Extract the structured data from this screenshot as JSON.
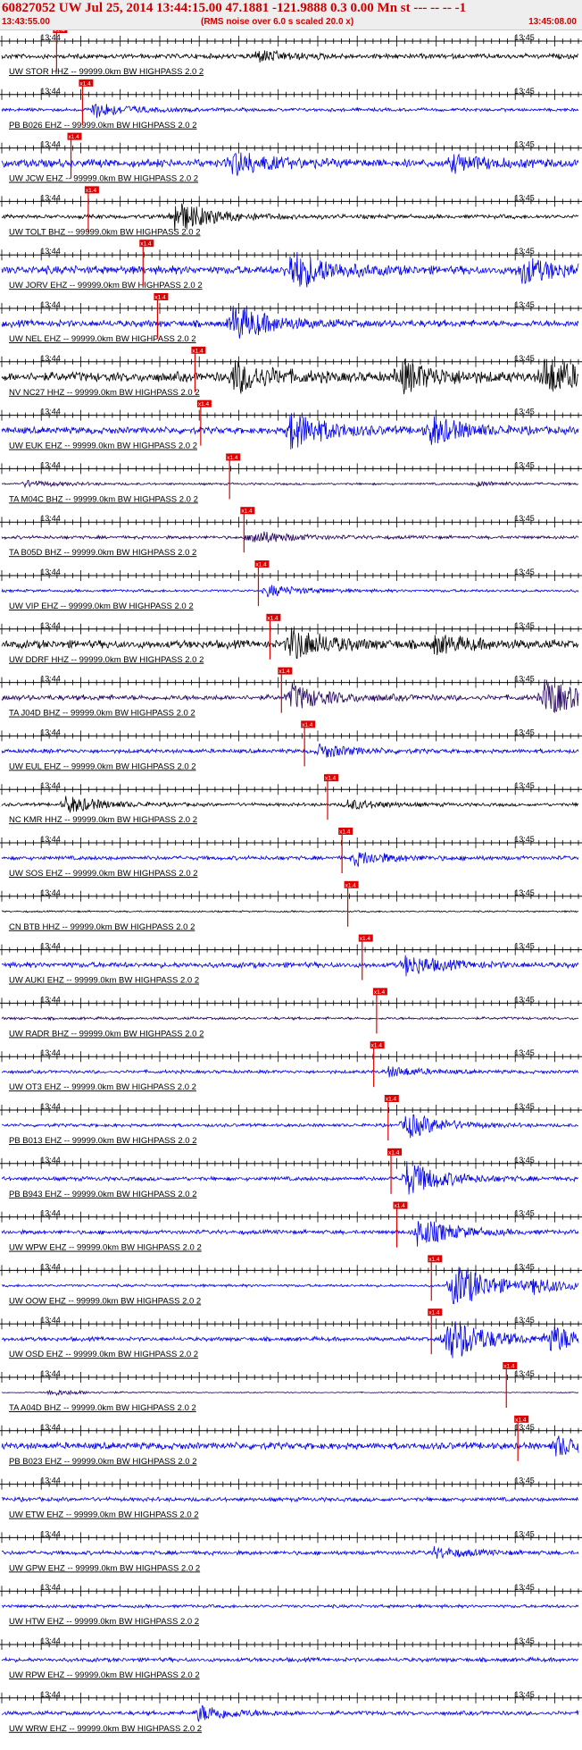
{
  "header": {
    "title": "60827052 UW Jul 25, 2014 13:44:15.00   47.1881 -121.9888  0.3 0.00 Mn st --- -- --  -1",
    "start_time": "13:43:55.00",
    "note": "(RMS noise over 6.0 s scaled 20.0 x)",
    "end_time": "13:45:08.00"
  },
  "chart_data": {
    "type": "seismogram",
    "time_range": [
      "13:43:55.00",
      "13:45:08.00"
    ],
    "time_labels": [
      "13:44",
      "13:45"
    ],
    "pick_flag_label": "x1.4",
    "colors": {
      "pick": "#dd0000",
      "black": "#000000",
      "blue": "#0000ee",
      "navy": "#22005e",
      "axis": "#000000"
    },
    "traces": [
      {
        "label": "UW STOR HHZ -- 99999.0km BW  HIGHPASS  2.0  2",
        "color": "black",
        "pick": 0.095,
        "amp": 0.18,
        "bursts": [
          [
            0.44,
            0.35
          ]
        ]
      },
      {
        "label": "PB B026 EHZ -- 99999.0km BW  HIGHPASS  2.0  2",
        "color": "blue",
        "pick": 0.14,
        "amp": 0.12,
        "bursts": [
          [
            0.155,
            0.5
          ]
        ]
      },
      {
        "label": "UW JCW EHZ -- 99999.0km BW  HIGHPASS  2.0  2",
        "color": "blue",
        "pick": 0.12,
        "amp": 0.3,
        "bursts": [
          [
            0.4,
            0.7
          ],
          [
            0.78,
            0.45
          ]
        ]
      },
      {
        "label": "UW TOLT BHZ -- 99999.0km BW  HIGHPASS  2.0  2",
        "color": "black",
        "pick": 0.15,
        "amp": 0.15,
        "bursts": [
          [
            0.3,
            1.0
          ]
        ]
      },
      {
        "label": "UW JORV EHZ -- 99999.0km BW  HIGHPASS  2.0  2",
        "color": "blue",
        "pick": 0.245,
        "amp": 0.3,
        "bursts": [
          [
            0.5,
            1.3
          ],
          [
            0.9,
            0.8
          ]
        ]
      },
      {
        "label": "UW NEL EHZ -- 99999.0km BW  HIGHPASS  2.0  2",
        "color": "blue",
        "pick": 0.27,
        "amp": 0.25,
        "bursts": [
          [
            0.4,
            1.1
          ]
        ]
      },
      {
        "label": "NV NC27 HHZ -- 99999.0km BW  HIGHPASS  2.0  2",
        "color": "black",
        "pick": 0.335,
        "amp": 0.35,
        "bursts": [
          [
            0.4,
            1.0
          ],
          [
            0.69,
            1.0
          ],
          [
            0.94,
            1.2
          ]
        ]
      },
      {
        "label": "UW EUK EHZ -- 99999.0km BW  HIGHPASS  2.0  2",
        "color": "blue",
        "pick": 0.345,
        "amp": 0.25,
        "bursts": [
          [
            0.5,
            1.2
          ],
          [
            0.74,
            0.9
          ]
        ]
      },
      {
        "label": "TA M04C BHZ -- 99999.0km BW  HIGHPASS  2.0  2",
        "color": "navy",
        "pick": 0.395,
        "amp": 0.08,
        "bursts": [
          [
            0.04,
            0.2
          ],
          [
            0.82,
            0.15
          ]
        ]
      },
      {
        "label": "TA B05D BHZ -- 99999.0km BW  HIGHPASS  2.0  2",
        "color": "navy",
        "pick": 0.42,
        "amp": 0.12,
        "bursts": [
          [
            0.43,
            0.45
          ]
        ]
      },
      {
        "label": "UW VIP EHZ -- 99999.0km BW  HIGHPASS  2.0  2",
        "color": "blue",
        "pick": 0.445,
        "amp": 0.1,
        "bursts": [
          [
            0.46,
            0.35
          ]
        ]
      },
      {
        "label": "UW DDRF HHZ -- 99999.0km BW  HIGHPASS  2.0  2",
        "color": "black",
        "pick": 0.465,
        "amp": 0.3,
        "bursts": [
          [
            0.5,
            1.0
          ],
          [
            0.75,
            0.5
          ]
        ]
      },
      {
        "label": "TA J04D BHZ -- 99999.0km BW  HIGHPASS  2.0  2",
        "color": "navy",
        "pick": 0.485,
        "amp": 0.2,
        "bursts": [
          [
            0.5,
            0.8
          ],
          [
            0.94,
            1.2
          ]
        ]
      },
      {
        "label": "UW EUL EHZ -- 99999.0km BW  HIGHPASS  2.0  2",
        "color": "blue",
        "pick": 0.525,
        "amp": 0.15,
        "bursts": [
          [
            0.55,
            0.4
          ]
        ]
      },
      {
        "label": "NC KMR HHZ -- 99999.0km BW  HIGHPASS  2.0  2",
        "color": "black",
        "pick": 0.565,
        "amp": 0.12,
        "bursts": [
          [
            0.11,
            0.55
          ],
          [
            0.6,
            0.3
          ]
        ]
      },
      {
        "label": "UW SOS EHZ -- 99999.0km BW  HIGHPASS  2.0  2",
        "color": "blue",
        "pick": 0.59,
        "amp": 0.15,
        "bursts": [
          [
            0.61,
            0.45
          ]
        ]
      },
      {
        "label": "CN BTB HHZ -- 99999.0km BW  HIGHPASS  2.0  2",
        "color": "black",
        "pick": 0.6,
        "amp": 0.06,
        "bursts": []
      },
      {
        "label": "UW AUKI EHZ -- 99999.0km BW  HIGHPASS  2.0  2",
        "color": "blue",
        "pick": 0.625,
        "amp": 0.2,
        "bursts": [
          [
            0.7,
            0.6
          ]
        ]
      },
      {
        "label": "UW RADR BHZ -- 99999.0km BW  HIGHPASS  2.0  2",
        "color": "navy",
        "pick": 0.65,
        "amp": 0.1,
        "bursts": []
      },
      {
        "label": "UW OT3 EHZ -- 99999.0km BW  HIGHPASS  2.0  2",
        "color": "blue",
        "pick": 0.645,
        "amp": 0.12,
        "bursts": [
          [
            0.67,
            0.3
          ]
        ]
      },
      {
        "label": "PB B013 EHZ -- 99999.0km BW  HIGHPASS  2.0  2",
        "color": "blue",
        "pick": 0.67,
        "amp": 0.12,
        "bursts": [
          [
            0.7,
            0.8
          ]
        ]
      },
      {
        "label": "PB B943 EHZ -- 99999.0km BW  HIGHPASS  2.0  2",
        "color": "blue",
        "pick": 0.675,
        "amp": 0.15,
        "bursts": [
          [
            0.7,
            1.1
          ]
        ]
      },
      {
        "label": "UW WPW EHZ -- 99999.0km BW  HIGHPASS  2.0  2",
        "color": "blue",
        "pick": 0.685,
        "amp": 0.15,
        "bursts": [
          [
            0.72,
            0.9
          ]
        ]
      },
      {
        "label": "UW OOW EHZ -- 99999.0km BW  HIGHPASS  2.0  2",
        "color": "blue",
        "pick": 0.745,
        "amp": 0.1,
        "bursts": [
          [
            0.78,
            1.6
          ],
          [
            0.92,
            0.4
          ]
        ]
      },
      {
        "label": "UW OSD EHZ -- 99999.0km BW  HIGHPASS  2.0  2",
        "color": "blue",
        "pick": 0.745,
        "amp": 0.15,
        "bursts": [
          [
            0.77,
            1.6
          ],
          [
            0.95,
            0.8
          ]
        ]
      },
      {
        "label": "TA A04D BHZ -- 99999.0km BW  HIGHPASS  2.0  2",
        "color": "navy",
        "pick": 0.875,
        "amp": 0.04,
        "bursts": [
          [
            0.08,
            0.2
          ]
        ]
      },
      {
        "label": "PB B023 EHZ -- 99999.0km BW  HIGHPASS  2.0  2",
        "color": "blue",
        "pick": 0.895,
        "amp": 0.25,
        "bursts": [
          [
            0.96,
            0.6
          ]
        ]
      },
      {
        "label": "UW ETW EHZ -- 99999.0km BW  HIGHPASS  2.0  2",
        "color": "blue",
        "pick": null,
        "amp": 0.15,
        "bursts": []
      },
      {
        "label": "UW GPW EHZ -- 99999.0km BW  HIGHPASS  2.0  2",
        "color": "blue",
        "pick": null,
        "amp": 0.15,
        "bursts": [
          [
            0.75,
            0.3
          ]
        ]
      },
      {
        "label": "UW HTW EHZ -- 99999.0km BW  HIGHPASS  2.0  2",
        "color": "blue",
        "pick": null,
        "amp": 0.12,
        "bursts": []
      },
      {
        "label": "UW RPW EHZ -- 99999.0km BW  HIGHPASS  2.0  2",
        "color": "blue",
        "pick": null,
        "amp": 0.15,
        "bursts": []
      },
      {
        "label": "UW WRW EHZ -- 99999.0km BW  HIGHPASS  2.0  2",
        "color": "blue",
        "pick": null,
        "amp": 0.15,
        "bursts": [
          [
            0.34,
            0.5
          ]
        ]
      }
    ]
  }
}
